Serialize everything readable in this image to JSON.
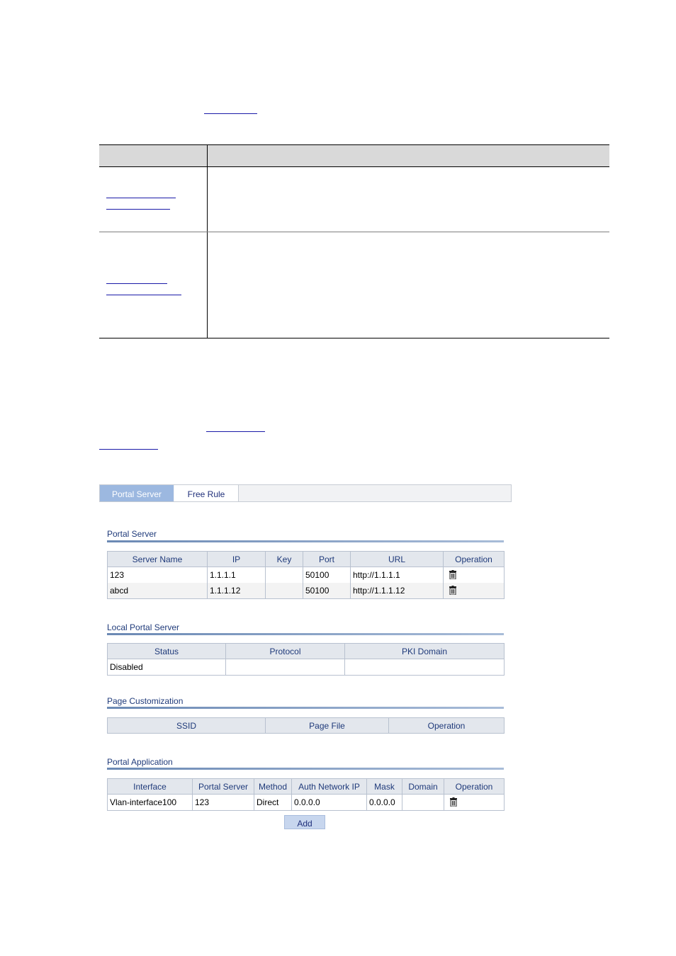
{
  "tabs": [
    {
      "label": "Portal Server",
      "active": true
    },
    {
      "label": "Free Rule",
      "active": false
    }
  ],
  "portal_server": {
    "title": "Portal Server",
    "columns": [
      "Server Name",
      "IP",
      "Key",
      "Port",
      "URL",
      "Operation"
    ],
    "rows": [
      {
        "server_name": "123",
        "ip": "1.1.1.1",
        "key": "",
        "port": "50100",
        "url": "http://1.1.1.1",
        "operation": "trash-icon"
      },
      {
        "server_name": "abcd",
        "ip": "1.1.1.12",
        "key": "",
        "port": "50100",
        "url": "http://1.1.1.12",
        "operation": "trash-icon"
      }
    ]
  },
  "local_portal_server": {
    "title": "Local Portal Server",
    "columns": [
      "Status",
      "Protocol",
      "PKI Domain"
    ],
    "rows": [
      {
        "status": "Disabled",
        "protocol": "",
        "pki_domain": ""
      }
    ]
  },
  "page_customization": {
    "title": "Page Customization",
    "columns": [
      "SSID",
      "Page File",
      "Operation"
    ],
    "rows": []
  },
  "portal_application": {
    "title": "Portal Application",
    "columns": [
      "Interface",
      "Portal Server",
      "Method",
      "Auth Network IP",
      "Mask",
      "Domain",
      "Operation"
    ],
    "rows": [
      {
        "interface": "Vlan-interface100",
        "portal_server": "123",
        "method": "Direct",
        "auth_network_ip": "0.0.0.0",
        "mask": "0.0.0.0",
        "domain": "",
        "operation": "trash-icon"
      }
    ],
    "add_label": "Add"
  },
  "colors": {
    "tab_active": "#9cb8e0",
    "header_bg": "#e3e7ed",
    "title_text": "#1f3a7a",
    "link": "#1a1aa8"
  }
}
